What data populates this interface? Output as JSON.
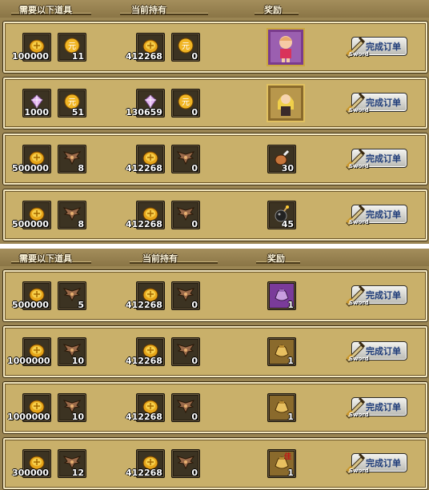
{
  "sections": [
    {
      "headers": {
        "need": "需要以下道具",
        "have": "当前持有",
        "reward": "奖励"
      },
      "rows": [
        {
          "need": [
            {
              "icon": "gold-coin-icon",
              "count": "100000"
            },
            {
              "icon": "yuan-coin-icon",
              "count": "11"
            }
          ],
          "have": [
            {
              "icon": "gold-coin-icon",
              "count": "412268"
            },
            {
              "icon": "yuan-coin-icon",
              "count": "0"
            }
          ],
          "reward": {
            "icon": "character-portrait-girl-icon",
            "count": ""
          },
          "button": "完成订单",
          "button_sub": "Sword"
        },
        {
          "need": [
            {
              "icon": "crystal-icon",
              "count": "1000"
            },
            {
              "icon": "yuan-coin-icon",
              "count": "51"
            }
          ],
          "have": [
            {
              "icon": "crystal-icon",
              "count": "130659"
            },
            {
              "icon": "yuan-coin-icon",
              "count": "0"
            }
          ],
          "reward": {
            "icon": "character-portrait-blonde-icon",
            "count": ""
          },
          "button": "完成订单",
          "button_sub": "Sword"
        },
        {
          "need": [
            {
              "icon": "gold-coin-icon",
              "count": "500000"
            },
            {
              "icon": "wing-emblem-icon",
              "count": "8"
            }
          ],
          "have": [
            {
              "icon": "gold-coin-icon",
              "count": "412268"
            },
            {
              "icon": "wing-emblem-icon",
              "count": "0"
            }
          ],
          "reward": {
            "icon": "meat-drumstick-icon",
            "count": "30"
          },
          "button": "完成订单",
          "button_sub": "Sword"
        },
        {
          "need": [
            {
              "icon": "gold-coin-icon",
              "count": "500000"
            },
            {
              "icon": "wing-emblem-icon",
              "count": "8"
            }
          ],
          "have": [
            {
              "icon": "gold-coin-icon",
              "count": "412268"
            },
            {
              "icon": "wing-emblem-icon",
              "count": "0"
            }
          ],
          "reward": {
            "icon": "bomb-icon",
            "count": "45"
          },
          "button": "完成订单",
          "button_sub": "Sword"
        }
      ]
    },
    {
      "headers": {
        "need": "需要以下道具",
        "have": "当前持有",
        "reward": "奖励"
      },
      "rows": [
        {
          "need": [
            {
              "icon": "gold-coin-icon",
              "count": "500000"
            },
            {
              "icon": "wing-emblem-icon",
              "count": "5"
            }
          ],
          "have": [
            {
              "icon": "gold-coin-icon",
              "count": "412268"
            },
            {
              "icon": "wing-emblem-icon",
              "count": "0"
            }
          ],
          "reward": {
            "icon": "purple-pouch-icon",
            "count": "1"
          },
          "button": "完成订单",
          "button_sub": "Sword"
        },
        {
          "need": [
            {
              "icon": "gold-coin-icon",
              "count": "1000000"
            },
            {
              "icon": "wing-emblem-icon",
              "count": "10"
            }
          ],
          "have": [
            {
              "icon": "gold-coin-icon",
              "count": "412268"
            },
            {
              "icon": "wing-emblem-icon",
              "count": "0"
            }
          ],
          "reward": {
            "icon": "gold-pouch-icon",
            "count": "1"
          },
          "button": "完成订单",
          "button_sub": "Sword"
        },
        {
          "need": [
            {
              "icon": "gold-coin-icon",
              "count": "1000000"
            },
            {
              "icon": "wing-emblem-icon",
              "count": "10"
            }
          ],
          "have": [
            {
              "icon": "gold-coin-icon",
              "count": "412268"
            },
            {
              "icon": "wing-emblem-icon",
              "count": "0"
            }
          ],
          "reward": {
            "icon": "gold-pouch-icon",
            "count": "1"
          },
          "button": "完成订单",
          "button_sub": "Sword"
        },
        {
          "need": [
            {
              "icon": "gold-coin-icon",
              "count": "300000"
            },
            {
              "icon": "wing-emblem-icon",
              "count": "12"
            }
          ],
          "have": [
            {
              "icon": "gold-coin-icon",
              "count": "412268"
            },
            {
              "icon": "wing-emblem-icon",
              "count": "0"
            }
          ],
          "reward": {
            "icon": "gold-pouch-tag-icon",
            "count": "1",
            "tag": "佳"
          },
          "button": "完成订单",
          "button_sub": "Sword"
        }
      ]
    }
  ]
}
